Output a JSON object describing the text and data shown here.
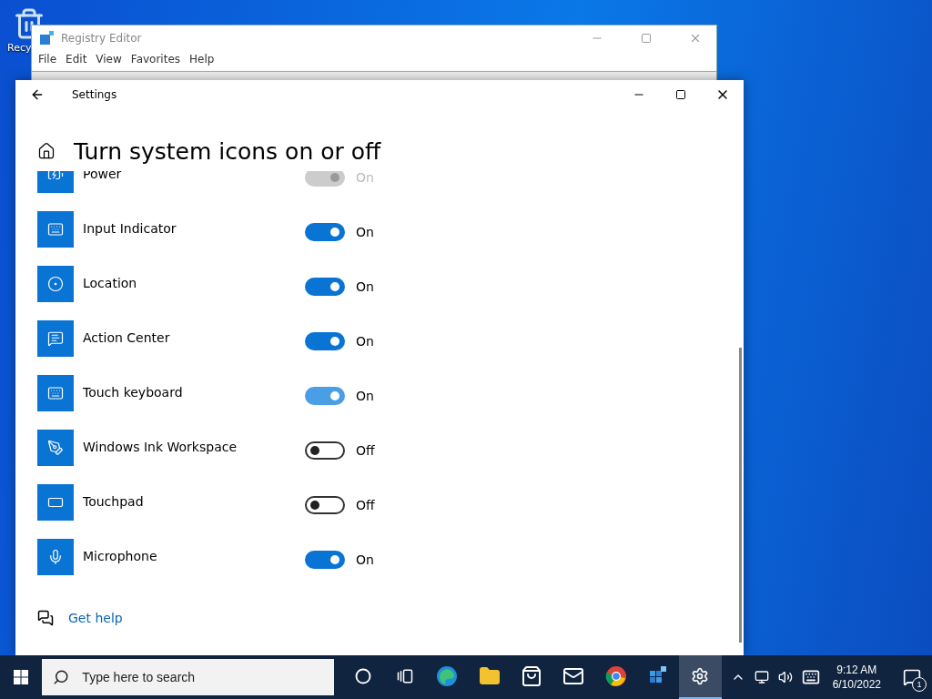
{
  "desktop": {
    "icons": [
      {
        "label": "Recy"
      }
    ]
  },
  "registry_editor": {
    "title": "Registry Editor",
    "menu": [
      "File",
      "Edit",
      "View",
      "Favorites",
      "Help"
    ]
  },
  "settings": {
    "title": "Settings",
    "heading": "Turn system icons on or off",
    "items": [
      {
        "kind": "power",
        "label": "Power",
        "on": true,
        "disabled": true,
        "hovered": false,
        "state": "On"
      },
      {
        "kind": "keyboard",
        "label": "Input Indicator",
        "on": true,
        "disabled": false,
        "hovered": false,
        "state": "On"
      },
      {
        "kind": "location",
        "label": "Location",
        "on": true,
        "disabled": false,
        "hovered": false,
        "state": "On"
      },
      {
        "kind": "action-center",
        "label": "Action Center",
        "on": true,
        "disabled": false,
        "hovered": false,
        "state": "On"
      },
      {
        "kind": "keyboard",
        "label": "Touch keyboard",
        "on": true,
        "disabled": false,
        "hovered": true,
        "state": "On"
      },
      {
        "kind": "pen",
        "label": "Windows Ink Workspace",
        "on": false,
        "disabled": false,
        "hovered": false,
        "state": "Off"
      },
      {
        "kind": "touchpad",
        "label": "Touchpad",
        "on": false,
        "disabled": false,
        "hovered": false,
        "state": "Off"
      },
      {
        "kind": "microphone",
        "label": "Microphone",
        "on": true,
        "disabled": false,
        "hovered": false,
        "state": "On"
      }
    ],
    "help_link": "Get help"
  },
  "taskbar": {
    "search": {
      "placeholder": "Type here to search"
    },
    "apps": [
      {
        "kind": "cortana",
        "selected": false
      },
      {
        "kind": "task-view",
        "selected": false
      },
      {
        "kind": "edge",
        "selected": false
      },
      {
        "kind": "explorer",
        "selected": false
      },
      {
        "kind": "store",
        "selected": false
      },
      {
        "kind": "mail",
        "selected": false
      },
      {
        "kind": "chrome",
        "selected": false
      },
      {
        "kind": "regedit",
        "selected": false
      },
      {
        "kind": "settings",
        "selected": true
      }
    ],
    "time": "9:12 AM",
    "date": "6/10/2022",
    "notifications": "1"
  }
}
